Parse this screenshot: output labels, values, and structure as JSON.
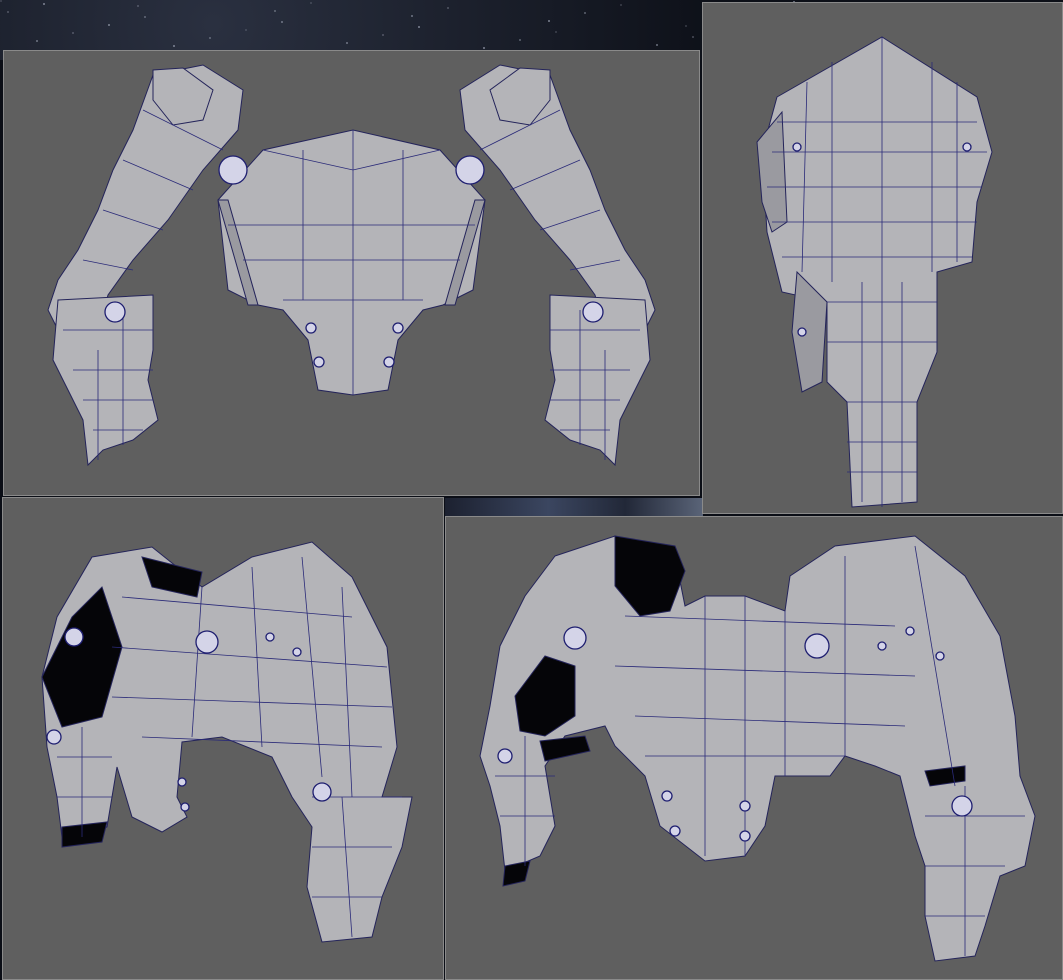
{
  "scene": {
    "subject": "",
    "viewports": [
      {
        "id": "front"
      },
      {
        "id": "side"
      },
      {
        "id": "perspective-left"
      },
      {
        "id": "perspective-right"
      }
    ]
  },
  "colors": {
    "viewport_bg": "#5f5f5f",
    "mesh_fill": "#b4b4b8",
    "wireframe": "#24245a",
    "backface": "#050508"
  }
}
